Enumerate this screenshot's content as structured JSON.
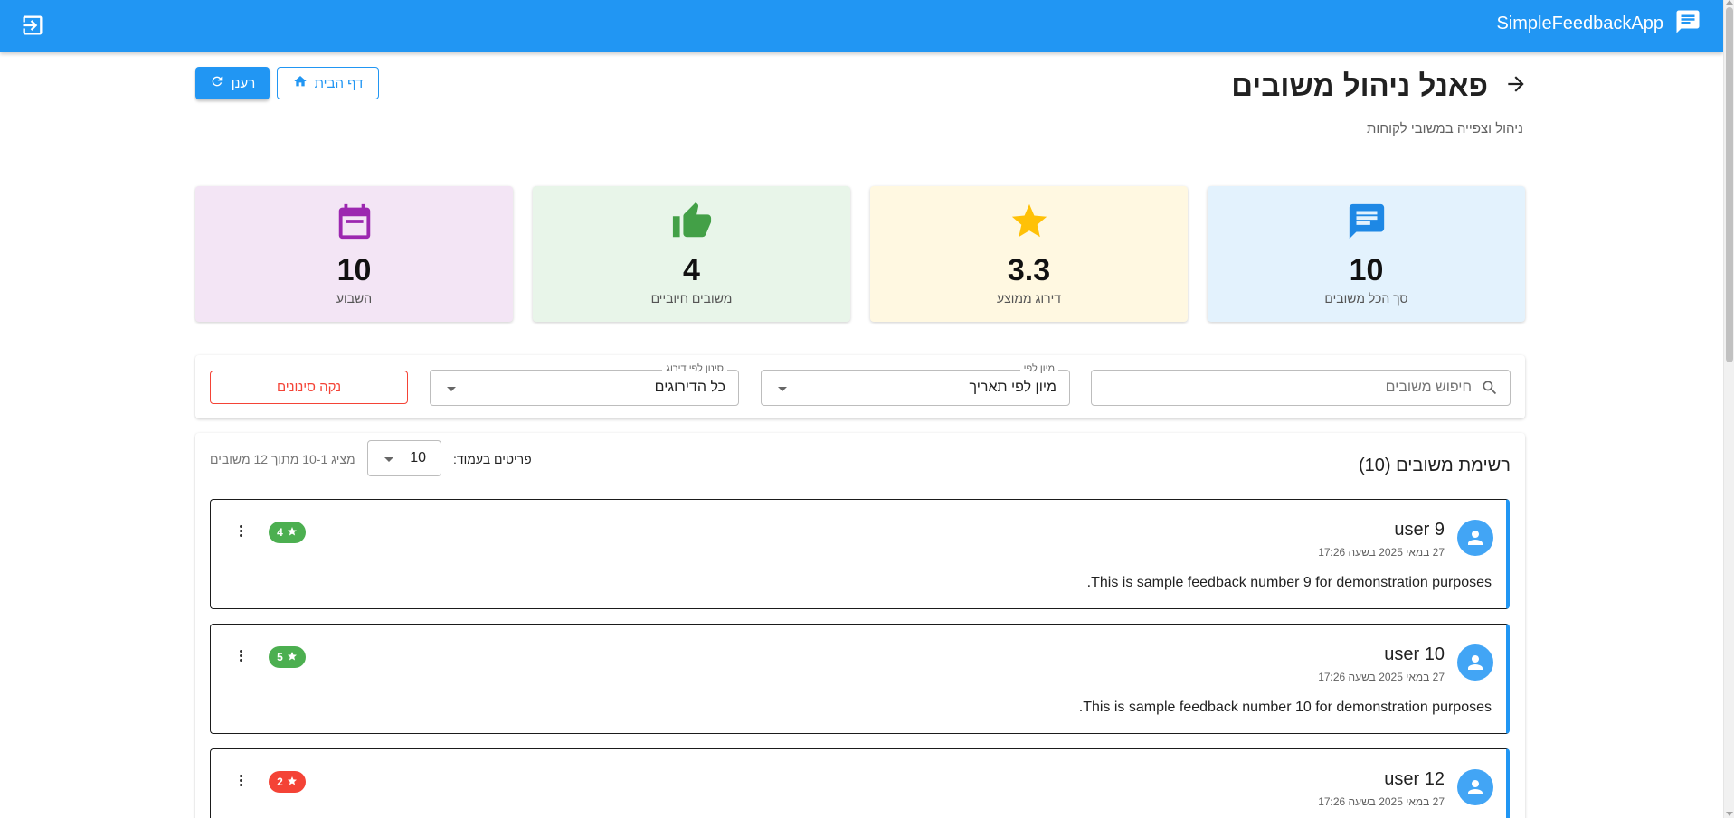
{
  "appbar": {
    "title": "SimpleFeedbackApp",
    "brand_icon": "feedback-icon",
    "logout_icon": "logout-icon"
  },
  "header": {
    "title": "פאנל ניהול משובים",
    "subtitle": "ניהול וצפייה במשובי לקוחות",
    "refresh_label": "רענן",
    "home_label": "דף הבית"
  },
  "stats": [
    {
      "icon": "chat-icon",
      "value": "10",
      "label": "סך הכל משובים",
      "bg": "#e3f2fd",
      "color": "#1e88e5"
    },
    {
      "icon": "star-icon",
      "value": "3.3",
      "label": "דירוג ממוצע",
      "bg": "#fff8e1",
      "color": "#ffc107"
    },
    {
      "icon": "thumb-up-icon",
      "value": "4",
      "label": "משובים חיוביים",
      "bg": "#e8f5e9",
      "color": "#43a047"
    },
    {
      "icon": "calendar-icon",
      "value": "10",
      "label": "השבוע",
      "bg": "#f3e5f5",
      "color": "#9c27b0"
    }
  ],
  "filters": {
    "search_placeholder": "חיפוש משובים",
    "sort_legend": "מיון לפי",
    "sort_value": "מיון לפי תאריך",
    "rating_legend": "סינון לפי דירוג",
    "rating_value": "כל הדירוגים",
    "clear_label": "נקה סינונים"
  },
  "list": {
    "title": "רשימת משובים (10)",
    "per_page_label": "פריטים בעמוד:",
    "per_page_value": "10",
    "range_info": "מציג 10-1 מתוך 12 משובים",
    "items": [
      {
        "user": "user 9",
        "date": "27 במאי 2025 בשעה 17:26",
        "message": "This is sample feedback number 9 for demonstration purposes.",
        "rating": "4",
        "rating_color": "#4caf50"
      },
      {
        "user": "user 10",
        "date": "27 במאי 2025 בשעה 17:26",
        "message": "This is sample feedback number 10 for demonstration purposes.",
        "rating": "5",
        "rating_color": "#4caf50"
      },
      {
        "user": "user 12",
        "date": "27 במאי 2025 בשעה 17:26",
        "message": "",
        "rating": "2",
        "rating_color": "#f44336"
      }
    ]
  },
  "colors": {
    "primary": "#2196f3",
    "danger": "#f44336",
    "success": "#4caf50"
  }
}
